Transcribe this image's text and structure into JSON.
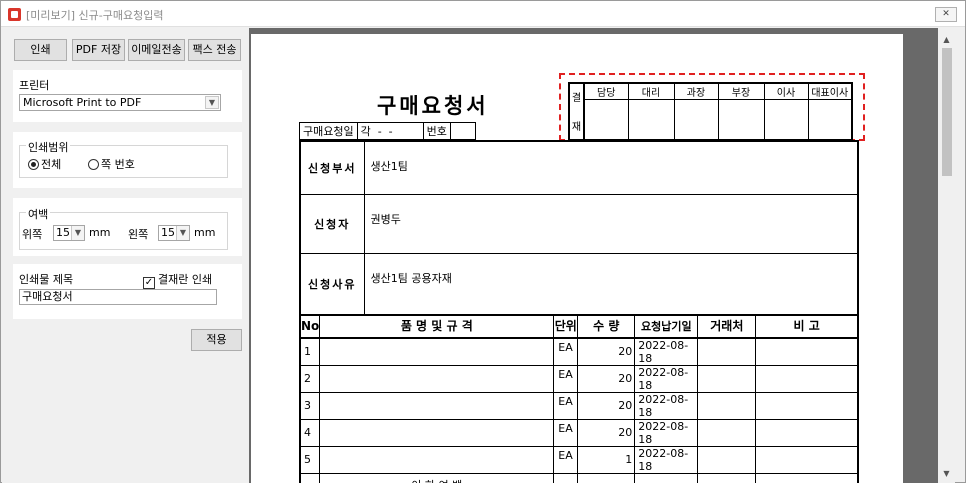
{
  "window": {
    "title": "[미리보기] 신규-구매요청입력",
    "close_icon": "close-icon"
  },
  "toolbar": {
    "print": "인쇄",
    "save_pdf": "PDF 저장",
    "email_send": "이메일전송",
    "fax_send": "팩스 전송"
  },
  "printer": {
    "label": "프린터",
    "selected": "Microsoft Print to PDF"
  },
  "print_range": {
    "label": "인쇄범위",
    "all": "전체",
    "page_numbers": "쪽 번호",
    "selected": "all"
  },
  "margins": {
    "label": "여백",
    "top_label": "위쪽",
    "top_value": "15",
    "left_label": "왼쪽",
    "left_value": "15",
    "unit": "mm"
  },
  "print_title": {
    "label": "인쇄물 제목",
    "approval_checkbox_label": "결재란 인쇄",
    "approval_checked": true,
    "value": "구매요청서"
  },
  "apply_button": "적용",
  "document": {
    "title": "구매요청서",
    "approval": {
      "side_label_top": "결",
      "side_label_bottom": "재",
      "positions": [
        "담당",
        "대리",
        "과장",
        "부장",
        "이사",
        "대표이사"
      ]
    },
    "request_date_label": "구매요청일",
    "request_date_value": "각  -  -",
    "number_label": "번호",
    "department_label": "신청부서",
    "department_value": "생산1팀",
    "applicant_label": "신청자",
    "applicant_value": "권병두",
    "reason_label": "신청사유",
    "reason_value": "생산1팀 공용자재",
    "columns": [
      "No",
      "품 명  및  규 격",
      "단위",
      "수 량",
      "요청납기일",
      "거래처",
      "비 고"
    ],
    "rows": [
      {
        "no": "1",
        "name": "",
        "unit": "EA",
        "qty": "20",
        "due": "2022-08-18",
        "vendor": "",
        "note": ""
      },
      {
        "no": "2",
        "name": "",
        "unit": "EA",
        "qty": "20",
        "due": "2022-08-18",
        "vendor": "",
        "note": ""
      },
      {
        "no": "3",
        "name": "",
        "unit": "EA",
        "qty": "20",
        "due": "2022-08-18",
        "vendor": "",
        "note": ""
      },
      {
        "no": "4",
        "name": "",
        "unit": "EA",
        "qty": "20",
        "due": "2022-08-18",
        "vendor": "",
        "note": ""
      },
      {
        "no": "5",
        "name": "",
        "unit": "EA",
        "qty": "1",
        "due": "2022-08-18",
        "vendor": "",
        "note": ""
      }
    ],
    "blank_note": "- 이 하 여 백 -"
  }
}
